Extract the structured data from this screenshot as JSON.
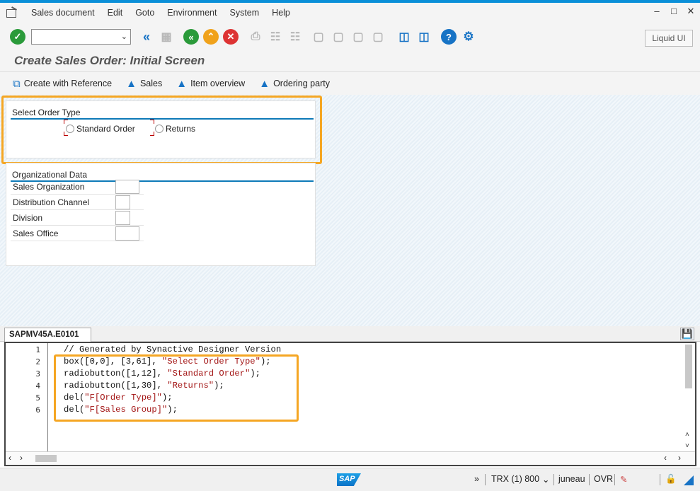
{
  "menu": [
    "Sales document",
    "Edit",
    "Goto",
    "Environment",
    "System",
    "Help"
  ],
  "toolbar": {
    "command_value": "",
    "liquid_ui_label": "Liquid UI"
  },
  "title": "Create Sales Order: Initial Screen",
  "app_toolbar": [
    "Create with Reference",
    "Sales",
    "Item overview",
    "Ordering party"
  ],
  "order_type_group": {
    "title": "Select Order Type",
    "radios": [
      "Standard Order",
      "Returns"
    ]
  },
  "org_data": {
    "title": "Organizational Data",
    "fields": [
      {
        "label": "Sales Organization",
        "value": ""
      },
      {
        "label": "Distribution Channel",
        "value": ""
      },
      {
        "label": "Division",
        "value": ""
      },
      {
        "label": "Sales Office",
        "value": ""
      }
    ]
  },
  "editor": {
    "tab": "SAPMV45A.E0101",
    "line_numbers": [
      "1",
      "2",
      "3",
      "4",
      "5",
      "6"
    ],
    "lines": [
      {
        "kind": "comment",
        "text": "// Generated by Synactive Designer Version"
      },
      {
        "kind": "code",
        "pre": "box([0,0], [3,61], ",
        "str": "\"Select Order Type\"",
        "post": ");"
      },
      {
        "kind": "code",
        "pre": "radiobutton([1,12], ",
        "str": "\"Standard Order\"",
        "post": ");"
      },
      {
        "kind": "code",
        "pre": "radiobutton([1,30], ",
        "str": "\"Returns\"",
        "post": ");"
      },
      {
        "kind": "code",
        "pre": "del(",
        "str": "\"F[Order Type]\"",
        "post": ");"
      },
      {
        "kind": "code",
        "pre": "del(",
        "str": "\"F[Sales Group]\"",
        "post": ");"
      }
    ]
  },
  "status": {
    "arrows": "»",
    "trx": "TRX (1) 800",
    "server": "juneau",
    "mode": "OVR"
  },
  "colors": {
    "accent": "#f5a623",
    "sap_blue": "#0a8fd8",
    "group_line": "#0e7ab8"
  }
}
